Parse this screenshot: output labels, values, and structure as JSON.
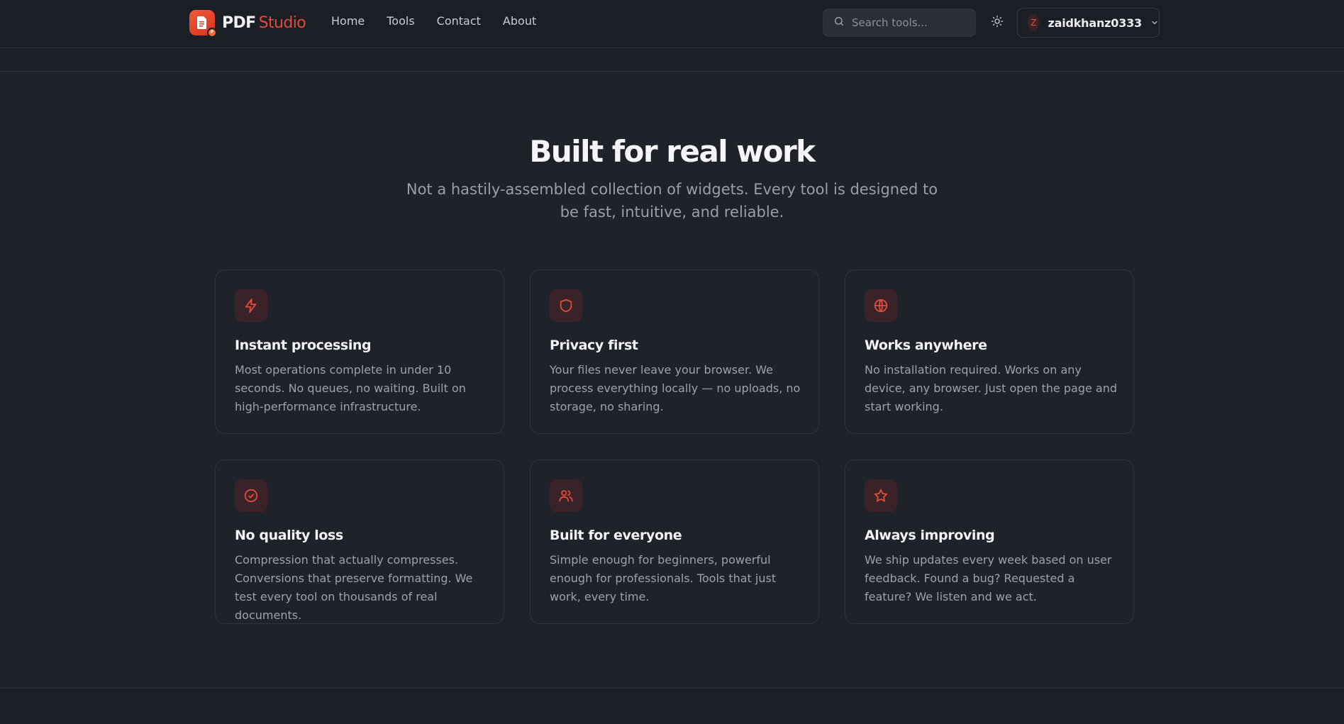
{
  "brand": {
    "name_part1": "PDF",
    "name_part2": "Studio",
    "badge": "P"
  },
  "nav": {
    "links": [
      "Home",
      "Tools",
      "Contact",
      "About"
    ]
  },
  "search": {
    "placeholder": "Search tools..."
  },
  "user": {
    "avatar_initial": "Z",
    "username": "zaidkhanz0333"
  },
  "hero": {
    "title": "Built for real work",
    "subtitle": "Not a hastily-assembled collection of widgets. Every tool is designed to be fast, intuitive, and reliable."
  },
  "features": [
    {
      "icon": "lightning-icon",
      "title": "Instant processing",
      "description": "Most operations complete in under 10 seconds. No queues, no waiting. Built on high-performance infrastructure."
    },
    {
      "icon": "shield-icon",
      "title": "Privacy first",
      "description": "Your files never leave your browser. We process everything locally — no uploads, no storage, no sharing."
    },
    {
      "icon": "globe-icon",
      "title": "Works anywhere",
      "description": "No installation required. Works on any device, any browser. Just open the page and start working."
    },
    {
      "icon": "check-circle-icon",
      "title": "No quality loss",
      "description": "Compression that actually compresses. Conversions that preserve formatting. We test every tool on thousands of real documents."
    },
    {
      "icon": "users-icon",
      "title": "Built for everyone",
      "description": "Simple enough for beginners, powerful enough for professionals. Tools that just work, every time."
    },
    {
      "icon": "star-icon",
      "title": "Always improving",
      "description": "We ship updates every week based on user feedback. Found a bug? Requested a feature? We listen and we act."
    }
  ],
  "colors": {
    "accent": "#e24a3b",
    "background": "#1f2229",
    "icon_tile": "#3a2328"
  }
}
